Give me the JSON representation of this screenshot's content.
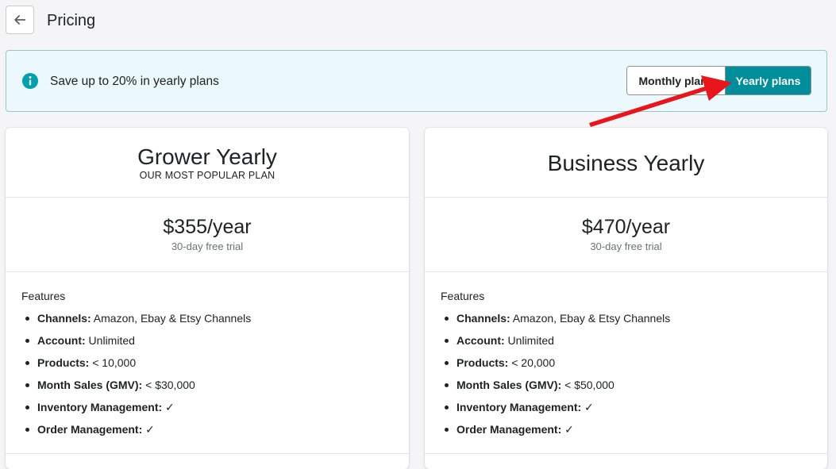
{
  "header": {
    "title": "Pricing",
    "back_icon": "arrow-left-icon"
  },
  "banner": {
    "icon": "info-icon",
    "text": "Save up to 20% in yearly plans",
    "toggle": {
      "monthly_label": "Monthly plans",
      "yearly_label": "Yearly plans",
      "selected": "yearly"
    },
    "accent_color": "#008e9b"
  },
  "annotation": {
    "arrow_color": "#e8161c"
  },
  "plans": [
    {
      "name": "Grower Yearly",
      "tagline": "OUR MOST POPULAR PLAN",
      "price": "$355/year",
      "trial": "30-day free trial",
      "features_title": "Features",
      "features": [
        {
          "label": "Channels:",
          "value": " Amazon, Ebay & Etsy Channels"
        },
        {
          "label": "Account:",
          "value": " Unlimited"
        },
        {
          "label": "Products:",
          "value": " < 10,000"
        },
        {
          "label": "Month Sales (GMV):",
          "value": " < $30,000"
        },
        {
          "label": "Inventory Management:",
          "value": " ✓"
        },
        {
          "label": "Order Management:",
          "value": " ✓"
        }
      ]
    },
    {
      "name": "Business Yearly",
      "tagline": "",
      "price": "$470/year",
      "trial": "30-day free trial",
      "features_title": "Features",
      "features": [
        {
          "label": "Channels:",
          "value": " Amazon, Ebay & Etsy Channels"
        },
        {
          "label": "Account:",
          "value": " Unlimited"
        },
        {
          "label": "Products:",
          "value": " < 20,000"
        },
        {
          "label": "Month Sales (GMV):",
          "value": " < $50,000"
        },
        {
          "label": "Inventory Management:",
          "value": " ✓"
        },
        {
          "label": "Order Management:",
          "value": " ✓"
        }
      ]
    }
  ]
}
